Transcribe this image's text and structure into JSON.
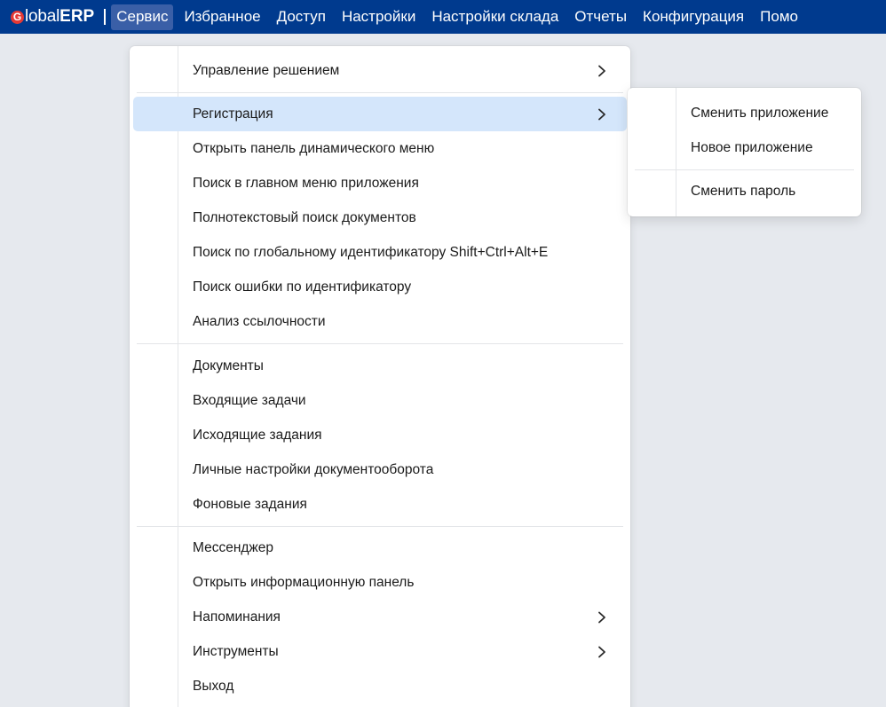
{
  "app": {
    "logo_mark": "G",
    "logo_light": "lobal",
    "logo_bold": "ERP"
  },
  "menubar": {
    "items": [
      {
        "label": "Сервис"
      },
      {
        "label": "Избранное"
      },
      {
        "label": "Доступ"
      },
      {
        "label": "Настройки"
      },
      {
        "label": "Настройки склада"
      },
      {
        "label": "Отчеты"
      },
      {
        "label": "Конфигурация"
      },
      {
        "label": "Помо"
      }
    ]
  },
  "dropdown": {
    "items": [
      {
        "label": "Управление решением",
        "has_submenu": true
      },
      {
        "label": "Регистрация",
        "has_submenu": true,
        "highlighted": true
      },
      {
        "label": "Открыть панель динамического меню"
      },
      {
        "label": "Поиск в главном меню приложения"
      },
      {
        "label": "Полнотекстовый поиск документов"
      },
      {
        "label": "Поиск по глобальному идентификатору Shift+Ctrl+Alt+E"
      },
      {
        "label": "Поиск ошибки по идентификатору"
      },
      {
        "label": "Анализ ссылочности"
      },
      {
        "label": "Документы"
      },
      {
        "label": "Входящие задачи"
      },
      {
        "label": "Исходящие задания"
      },
      {
        "label": "Личные настройки документооборота"
      },
      {
        "label": "Фоновые задания"
      },
      {
        "label": "Мессенджер"
      },
      {
        "label": "Открыть информационную панель"
      },
      {
        "label": "Напоминания",
        "has_submenu": true
      },
      {
        "label": "Инструменты",
        "has_submenu": true
      },
      {
        "label": "Выход"
      }
    ]
  },
  "submenu": {
    "items": [
      {
        "label": "Сменить приложение"
      },
      {
        "label": "Новое приложение"
      },
      {
        "label": "Сменить пароль"
      }
    ]
  },
  "colors": {
    "menubar_bg": "#003a8e",
    "active_menubar_item": "#3a5fa7",
    "highlight": "#d4e6fb",
    "logo_accent": "#e53935",
    "desktop_bg": "#e6e9ee"
  }
}
